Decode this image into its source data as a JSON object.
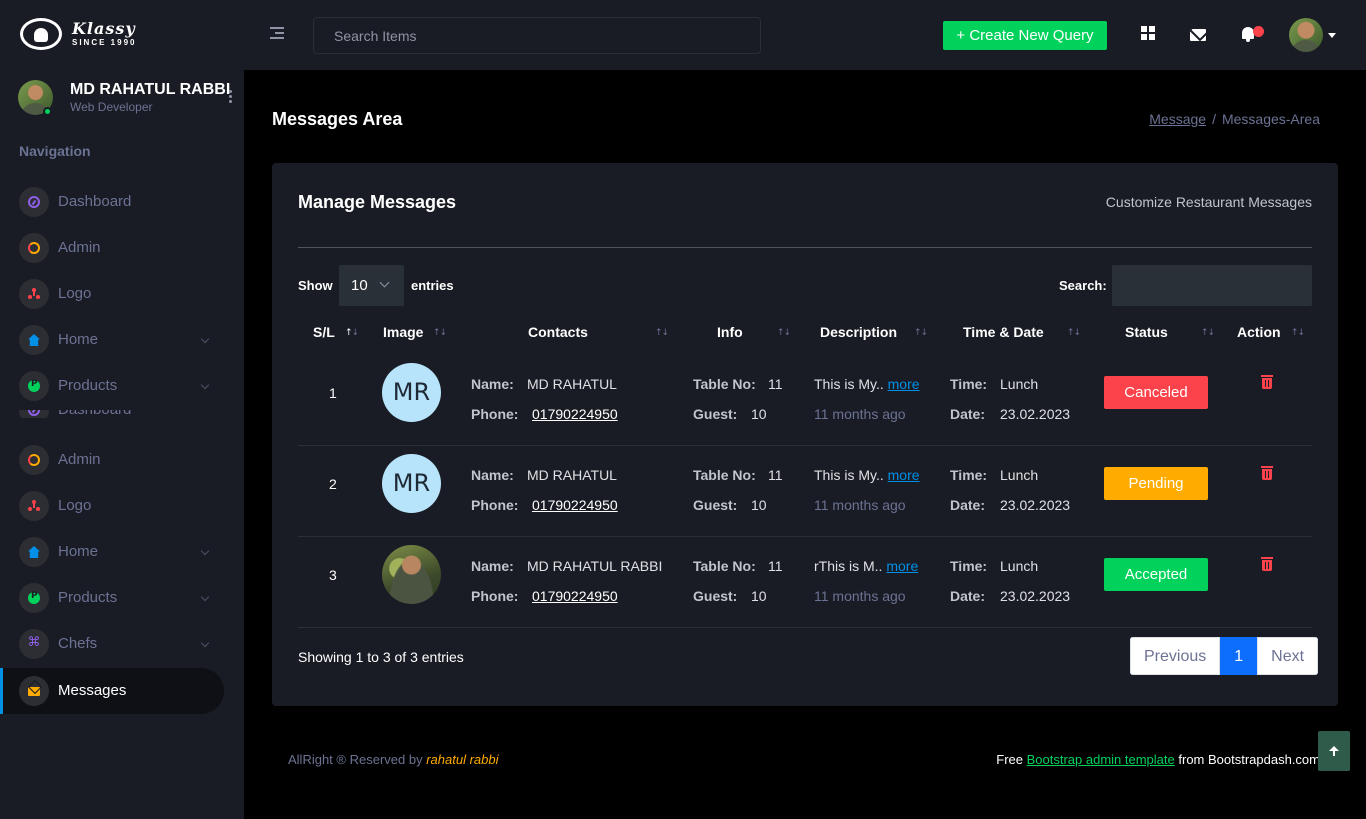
{
  "brand": {
    "name": "Klassy",
    "since": "SINCE 1990"
  },
  "topbar": {
    "search_placeholder": "Search Items",
    "create_label": "+ Create New Query"
  },
  "profile": {
    "name": "MD RAHATUL RABBI",
    "role": "Web Developer"
  },
  "sidebar": {
    "heading": "Navigation",
    "items": [
      {
        "label": "Dashboard",
        "icon": "speedometer-icon"
      },
      {
        "label": "Admin",
        "icon": "admin-icon"
      },
      {
        "label": "Logo",
        "icon": "logo-icon"
      },
      {
        "label": "Home",
        "icon": "home-icon"
      },
      {
        "label": "Products",
        "icon": "products-icon"
      },
      {
        "label": "Dashboard",
        "icon": "speedometer-icon"
      },
      {
        "label": "Admin",
        "icon": "admin-icon"
      },
      {
        "label": "Logo",
        "icon": "logo-icon"
      },
      {
        "label": "Home",
        "icon": "home-icon"
      },
      {
        "label": "Products",
        "icon": "products-icon"
      },
      {
        "label": "Chefs",
        "icon": "chefs-icon"
      },
      {
        "label": "Messages",
        "icon": "mail-icon"
      }
    ]
  },
  "page": {
    "title": "Messages Area",
    "breadcrumb": {
      "link": "Message",
      "current": "Messages-Area"
    }
  },
  "card": {
    "title": "Manage Messages",
    "link": "Customize Restaurant Messages",
    "show_label": "Show",
    "show_value": "10",
    "entries_label": "entries",
    "search_label": "Search:",
    "columns": [
      "S/L",
      "Image",
      "Contacts",
      "Info",
      "Description",
      "Time & Date",
      "Status",
      "Action"
    ],
    "labels": {
      "name": "Name:",
      "phone": "Phone:",
      "table": "Table No:",
      "guest": "Guest:",
      "time": "Time:",
      "date": "Date:",
      "more": "more"
    },
    "rows": [
      {
        "sl": "1",
        "initials": "MR",
        "name": "MD RAHATUL",
        "phone": "01790224950",
        "table": "11",
        "guest": "10",
        "desc": "This is My..",
        "ago": "11 months ago",
        "time": "Lunch",
        "date": "23.02.2023",
        "status": "Canceled",
        "status_color": "#fc424a"
      },
      {
        "sl": "2",
        "initials": "MR",
        "name": "MD RAHATUL",
        "phone": "01790224950",
        "table": "11",
        "guest": "10",
        "desc": "This is My..",
        "ago": "11 months ago",
        "time": "Lunch",
        "date": "23.02.2023",
        "status": "Pending",
        "status_color": "#ffab00"
      },
      {
        "sl": "3",
        "initials": "",
        "name": "MD RAHATUL RABBI",
        "phone": "01790224950",
        "table": "11",
        "guest": "10",
        "desc": "rThis is M..",
        "ago": "11 months ago",
        "time": "Lunch",
        "date": "23.02.2023",
        "status": "Accepted",
        "status_color": "#00d25b"
      }
    ],
    "info": "Showing 1 to 3 of 3 entries",
    "pager": {
      "prev": "Previous",
      "current": "1",
      "next": "Next"
    }
  },
  "footer": {
    "left_text": "AllRight ® Reserved by",
    "left_name": "rahatul rabbi",
    "right_prefix": "Free",
    "right_link": "Bootstrap admin template",
    "right_suffix": "from Bootstrapdash.com"
  },
  "colors": {
    "accent": "#00d25b",
    "primary": "#0090e7",
    "danger": "#fc424a",
    "warning": "#ffab00"
  }
}
